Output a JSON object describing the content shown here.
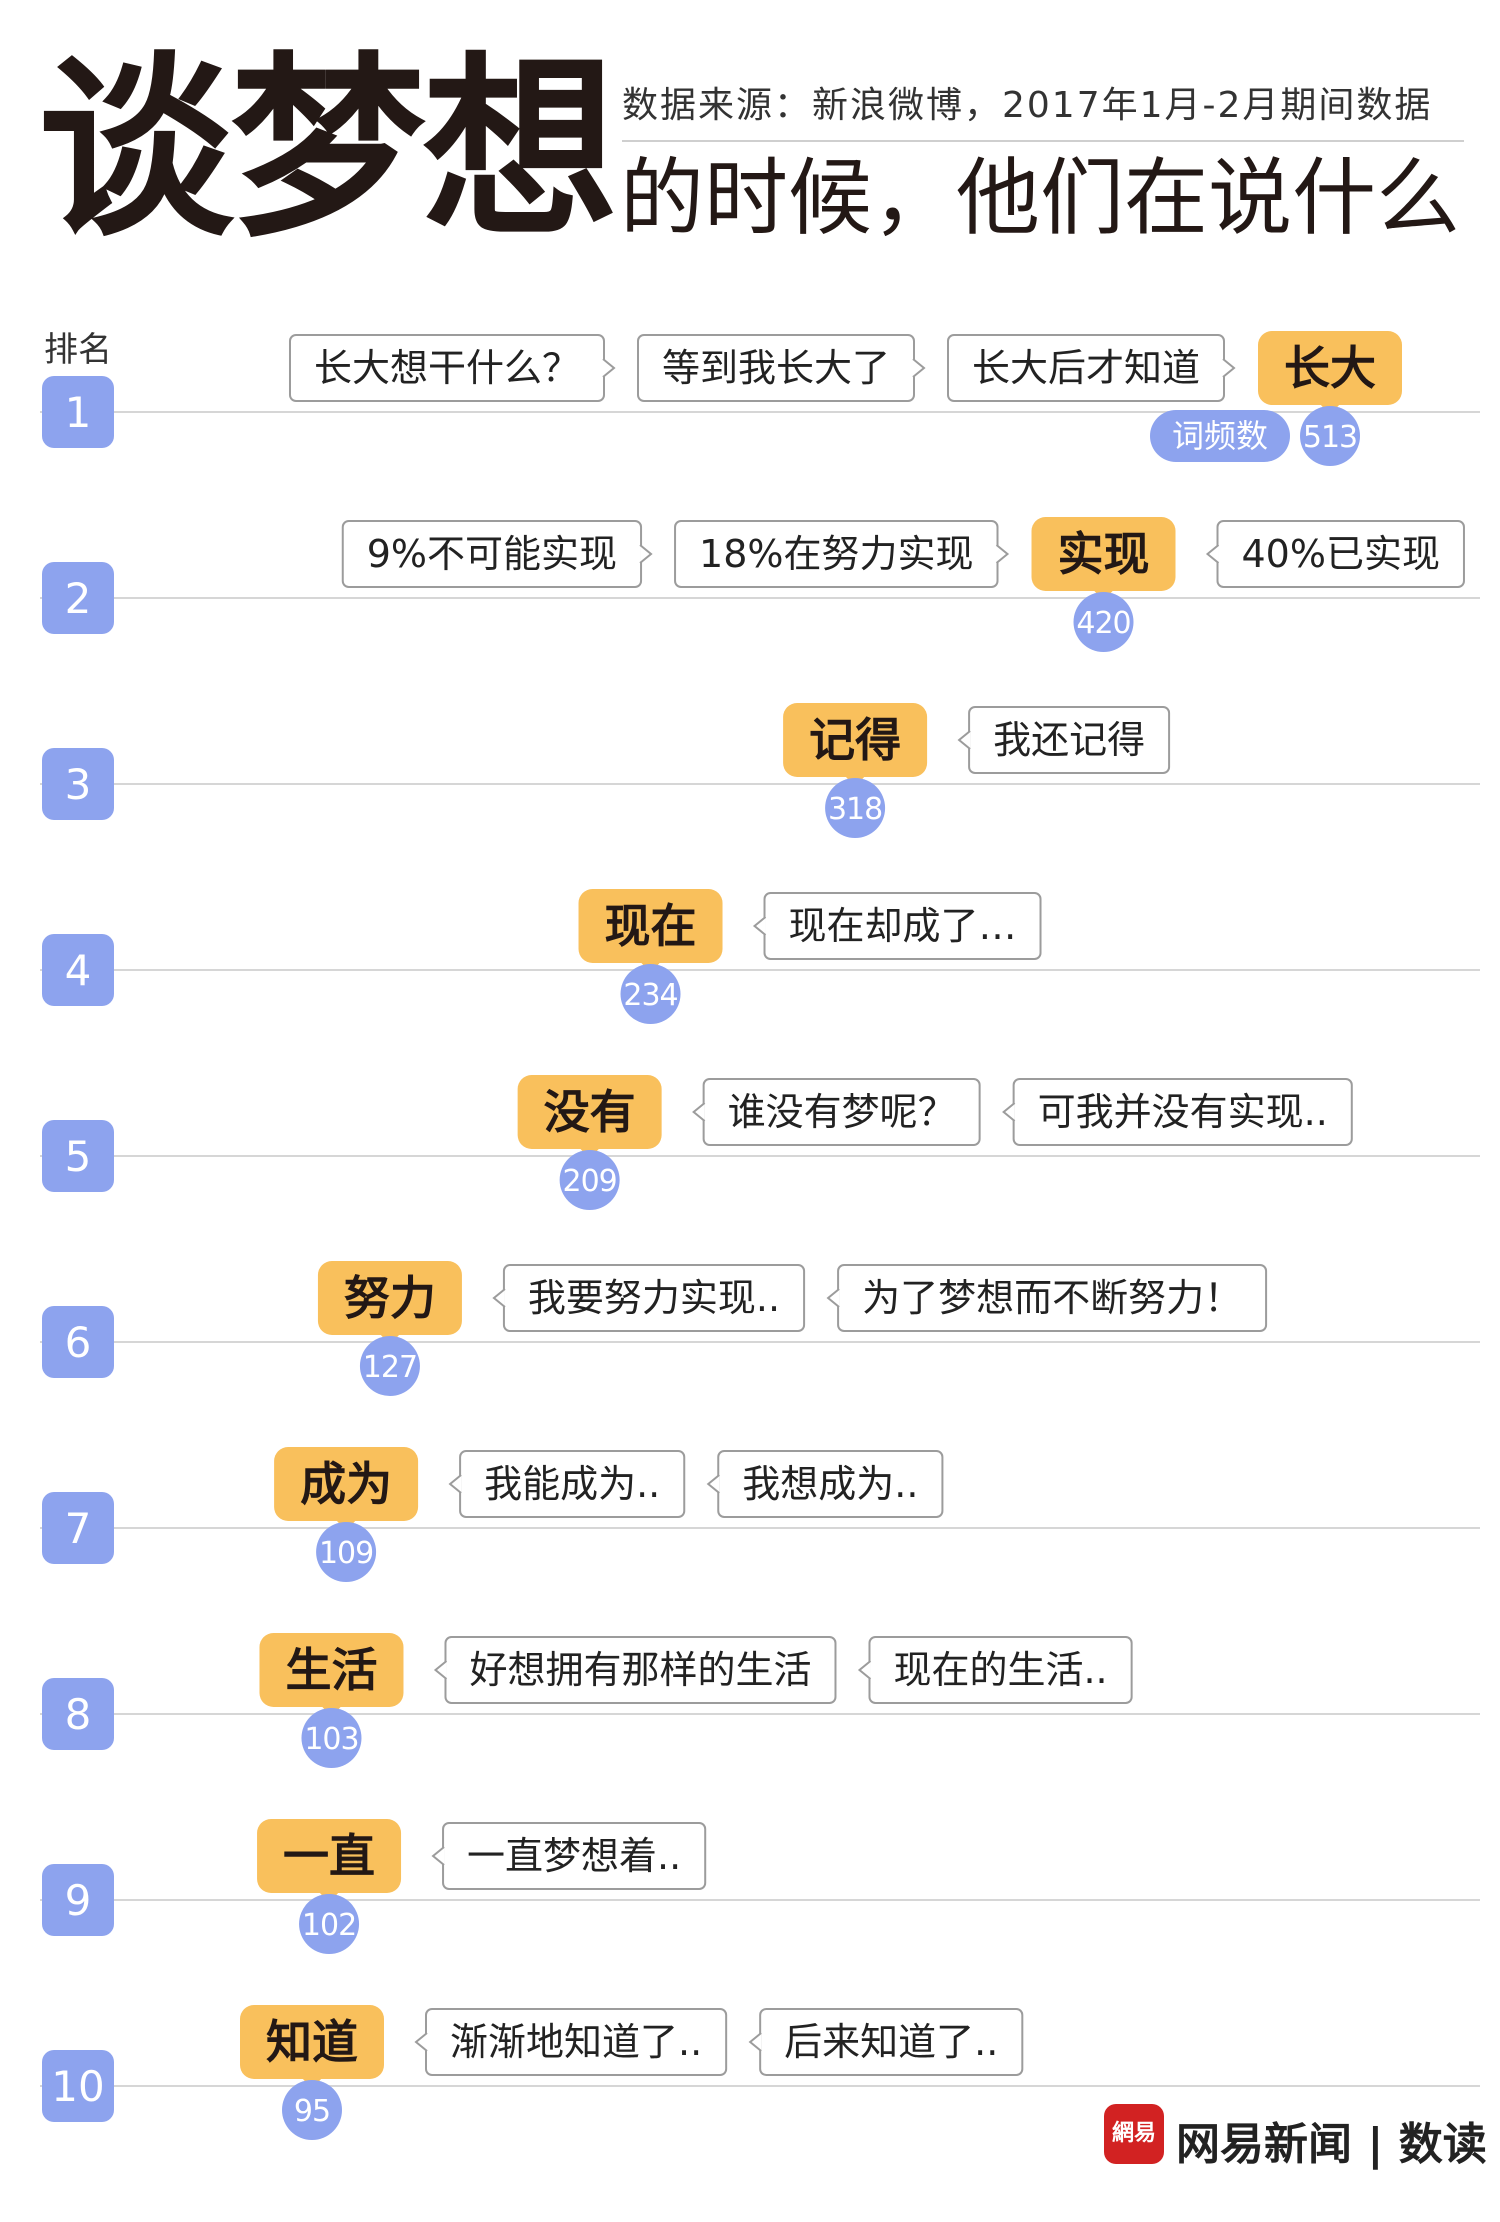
{
  "header": {
    "title_big": "谈梦想",
    "source": "数据来源：新浪微博，2017年1月-2月期间数据",
    "subtitle": "的时候，他们在说什么",
    "rank_label": "排名"
  },
  "chart_data": {
    "type": "ranked-bubble",
    "title": "谈梦想的时候，他们在说什么",
    "legend": "词频数",
    "colors": {
      "keyword": "#f9c05c",
      "count": "#8da3ee",
      "rank": "#8da3ee",
      "phrase_border": "#9c9c9c",
      "line": "#d6d6d6"
    },
    "ranks": [
      {
        "rank": 1,
        "keyword": "长大",
        "count": 513,
        "before": [
          "长大想干什么？",
          "等到我长大了",
          "长大后才知道"
        ],
        "after": []
      },
      {
        "rank": 2,
        "keyword": "实现",
        "count": 420,
        "before": [
          "9%不可能实现",
          "18%在努力实现"
        ],
        "after": [
          "40%已实现"
        ]
      },
      {
        "rank": 3,
        "keyword": "记得",
        "count": 318,
        "before": [],
        "after": [
          "我还记得"
        ]
      },
      {
        "rank": 4,
        "keyword": "现在",
        "count": 234,
        "before": [],
        "after": [
          "现在却成了…"
        ]
      },
      {
        "rank": 5,
        "keyword": "没有",
        "count": 209,
        "before": [],
        "after": [
          "谁没有梦呢？",
          "可我并没有实现.."
        ]
      },
      {
        "rank": 6,
        "keyword": "努力",
        "count": 127,
        "before": [],
        "after": [
          "我要努力实现..",
          "为了梦想而不断努力！"
        ]
      },
      {
        "rank": 7,
        "keyword": "成为",
        "count": 109,
        "before": [],
        "after": [
          "我能成为..",
          "我想成为.."
        ]
      },
      {
        "rank": 8,
        "keyword": "生活",
        "count": 103,
        "before": [],
        "after": [
          "好想拥有那样的生活",
          "现在的生活.."
        ]
      },
      {
        "rank": 9,
        "keyword": "一直",
        "count": 102,
        "before": [],
        "after": [
          "一直梦想着.."
        ]
      },
      {
        "rank": 10,
        "keyword": "知道",
        "count": 95,
        "before": [],
        "after": [
          "渐渐地知道了..",
          "后来知道了.."
        ]
      }
    ]
  },
  "logo": {
    "mark": "網易",
    "text": "网易新闻 | 数读"
  }
}
